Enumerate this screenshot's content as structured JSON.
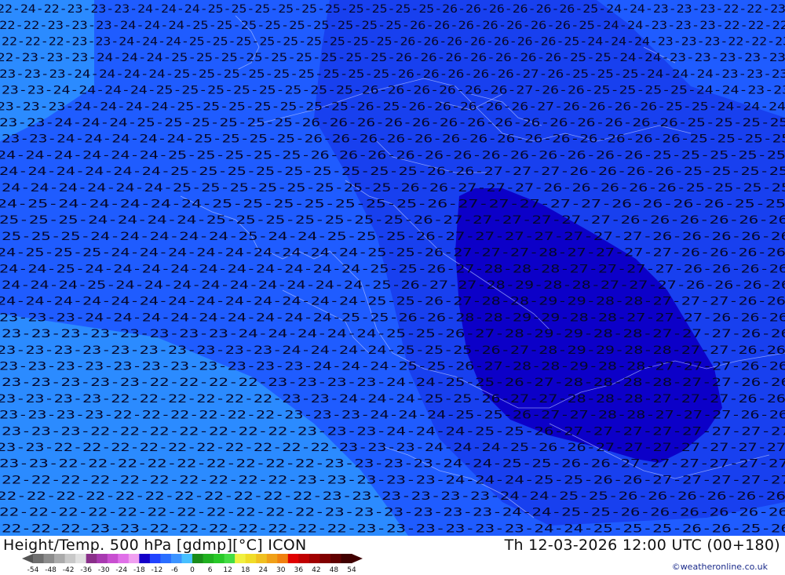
{
  "map": {
    "colors": {
      "t_minus22": "#2b8bff",
      "t_minus24": "#1f5cff",
      "t_minus26": "#1840ef",
      "t_minus28": "#0c00c8",
      "border": "#b8c4ff"
    },
    "label_rows": [
      "22 24 22 23 23 23 24 24 24 25 25 25 25 25 25 25 25 25 25 26 26 26 26 26 26 25 24 24 23 23 23 22 22 23",
      "22 22 23 23 23 24 24 24 25 25 25 25 25 25 25 25 25 26 26 26 26 26 26 26 25 24 24 23 23 23 22 22 22",
      "22 22 22 23 23 24 24 24 25 25 25 25 25 25 25 25 25 26 26 26 26 26 26 26 25 24 24 24 23 23 23 22 22 23",
      "22 23 23 23 24 24 24 25 25 25 25 25 25 25 25 25 26 26 26 26 26 26 26 25 25 24 24 23 23 23 23 23",
      "23 23 23 24 24 24 24 25 25 25 25 25 25 25 25 25 26 26 26 26 26 27 26 25 25 25 24 24 24 23 23 23",
      "23 23 24 24 24 24 25 25 25 25 25 25 25 25 26 26 26 26 26 26 27 26 26 25 25 25 25 24 24 23 23",
      "23 23 23 24 24 24 24 25 25 25 25 25 25 25 26 25 26 26 26 26 26 27 26 26 26 26 25 25 24 24 24",
      "23 23 24 24 24 25 25 25 25 25 25 26 26 26 26 26 26 26 26 26 26 26 26 26 26 25 25 25 25",
      "23 23 24 24 24 24 24 25 25 25 25 26 26 26 26 26 26 26 26 26 26 26 26 26 26 25 25 25 25",
      "24 24 24 24 24 24 25 25 25 25 25 26 26 26 26 26 26 26 26 26 26 26 26 25 25 25 25 25",
      "24 24 24 24 24 24 25 25 25 25 25 25 25 25 25 26 26 27 27 27 26 26 26 26 25 25 25 25",
      "24 24 24 24 24 24 25 25 25 25 25 25 25 25 26 26 27 27 27 26 26 26 26 26 25 25 25 25",
      "24 25 24 24 24 24 24 25 25 25 25 25 25 25 26 27 27 27 27 27 26 26 26 26 25 25",
      "25 25 25 24 24 24 24 25 25 25 25 25 25 25 26 27 27 27 27 27 27 26 26 26 26 26 26",
      "25 25 25 24 24 24 24 24 25 24 24 25 25 25 26 27 27 27 27 27 27 27 26 26 26 26 26",
      "24 25 25 25 24 24 24 24 24 24 24 24 24 25 25 26 27 27 27 28 27 27 27 27 26 26 26 26",
      "24 24 25 24 24 24 24 24 24 24 24 24 24 25 25 26 27 28 28 28 27 27 27 27 26 26 26 26",
      "24 24 24 25 24 24 24 24 24 24 24 24 24 25 26 27 27 28 29 28 28 27 27 27 26 26 26 26",
      "24 24 24 24 24 24 24 24 24 24 24 24 24 25 25 26 27 28 28 29 29 28 28 27 27 27 26 26",
      "23 23 23 24 24 24 24 24 24 24 24 24 25 25 26 26 28 28 29 29 28 28 27 27 27 26 26 26",
      "23 23 23 23 23 23 23 23 24 24 24 24 24 25 25 26 27 28 29 29 28 28 27 27 27 26 26",
      "23 23 23 23 23 23 23 23 23 23 24 24 24 24 25 25 25 26 27 28 29 29 28 28 27 27 26 26",
      "23 23 23 23 23 23 23 23 23 23 23 24 24 24 25 25 26 27 28 28 29 28 28 27 27 27 26 26",
      "23 23 23 23 23 22 22 22 22 23 23 23 23 24 24 25 25 26 27 28 28 28 28 27 27 26 26",
      "23 23 23 23 22 22 22 22 22 22 23 23 24 24 24 25 25 26 27 27 28 28 28 27 27 27 26 26",
      "23 23 23 23 22 22 22 22 22 22 23 23 23 24 24 24 25 25 26 27 27 28 28 27 27 27 26 26",
      "23 23 23 22 22 22 22 22 22 22 23 23 23 24 24 24 25 25 26 27 27 27 27 27 27 27 27",
      "23 23 22 22 22 22 22 22 22 22 22 22 23 23 23 24 24 24 25 26 26 27 27 27 27 27 27 27",
      "23 23 22 22 22 22 22 22 22 22 22 23 23 23 23 24 24 25 25 26 26 27 27 27 27 27 27",
      "22 22 22 22 22 22 22 22 22 22 23 23 23 23 23 24 24 24 25 25 26 26 27 27 27 27 27",
      "22 22 22 22 22 22 22 22 22 22 22 23 23 23 23 23 23 24 24 25 25 26 26 26 26 26 26",
      "22 22 22 22 22 22 22 22 22 22 22 23 23 23 23 23 23 24 24 25 25 26 26 26 26 26 26",
      "22 22 22 23 23 22 22 22 22 22 22 22 23 23 23 23 23 23 24 24 25 25 25 26 26 25 26"
    ]
  },
  "footer": {
    "title": "Height/Temp. 500 hPa [gdmp][°C] ICON",
    "datetime": "Th 12-03-2026 12:00 UTC (00+180)",
    "credit": "©weatheronline.co.uk",
    "scale_ticks": [
      "-54",
      "-48",
      "-42",
      "-36",
      "-30",
      "-24",
      "-18",
      "-12",
      "-6",
      "0",
      "6",
      "12",
      "18",
      "24",
      "30",
      "36",
      "42",
      "48",
      "54"
    ],
    "scale_colors": [
      "#6e6e6e",
      "#8c8c8c",
      "#aaaaaa",
      "#c8c8c8",
      "#e0e0e0",
      "#8a2f8a",
      "#a83ab0",
      "#c84fd0",
      "#e070e8",
      "#f0a0f0",
      "#1400c8",
      "#2244ff",
      "#2a6eff",
      "#3b93ff",
      "#47c0ff",
      "#1a8c1a",
      "#20b020",
      "#28c828",
      "#44dc44",
      "#f0f040",
      "#f0dc28",
      "#f0c020",
      "#f0a018",
      "#f08010",
      "#e00000",
      "#c00000",
      "#a00000",
      "#800000",
      "#600000",
      "#400000"
    ]
  }
}
